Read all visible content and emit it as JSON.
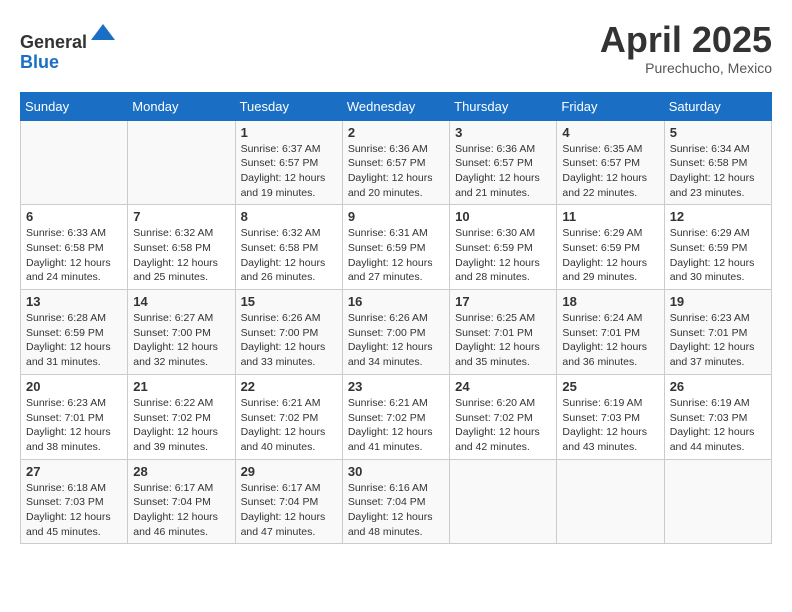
{
  "header": {
    "logo_line1": "General",
    "logo_line2": "Blue",
    "month": "April 2025",
    "location": "Purechucho, Mexico"
  },
  "weekdays": [
    "Sunday",
    "Monday",
    "Tuesday",
    "Wednesday",
    "Thursday",
    "Friday",
    "Saturday"
  ],
  "weeks": [
    [
      {
        "day": "",
        "sunrise": "",
        "sunset": "",
        "daylight": ""
      },
      {
        "day": "",
        "sunrise": "",
        "sunset": "",
        "daylight": ""
      },
      {
        "day": "1",
        "sunrise": "Sunrise: 6:37 AM",
        "sunset": "Sunset: 6:57 PM",
        "daylight": "Daylight: 12 hours and 19 minutes."
      },
      {
        "day": "2",
        "sunrise": "Sunrise: 6:36 AM",
        "sunset": "Sunset: 6:57 PM",
        "daylight": "Daylight: 12 hours and 20 minutes."
      },
      {
        "day": "3",
        "sunrise": "Sunrise: 6:36 AM",
        "sunset": "Sunset: 6:57 PM",
        "daylight": "Daylight: 12 hours and 21 minutes."
      },
      {
        "day": "4",
        "sunrise": "Sunrise: 6:35 AM",
        "sunset": "Sunset: 6:57 PM",
        "daylight": "Daylight: 12 hours and 22 minutes."
      },
      {
        "day": "5",
        "sunrise": "Sunrise: 6:34 AM",
        "sunset": "Sunset: 6:58 PM",
        "daylight": "Daylight: 12 hours and 23 minutes."
      }
    ],
    [
      {
        "day": "6",
        "sunrise": "Sunrise: 6:33 AM",
        "sunset": "Sunset: 6:58 PM",
        "daylight": "Daylight: 12 hours and 24 minutes."
      },
      {
        "day": "7",
        "sunrise": "Sunrise: 6:32 AM",
        "sunset": "Sunset: 6:58 PM",
        "daylight": "Daylight: 12 hours and 25 minutes."
      },
      {
        "day": "8",
        "sunrise": "Sunrise: 6:32 AM",
        "sunset": "Sunset: 6:58 PM",
        "daylight": "Daylight: 12 hours and 26 minutes."
      },
      {
        "day": "9",
        "sunrise": "Sunrise: 6:31 AM",
        "sunset": "Sunset: 6:59 PM",
        "daylight": "Daylight: 12 hours and 27 minutes."
      },
      {
        "day": "10",
        "sunrise": "Sunrise: 6:30 AM",
        "sunset": "Sunset: 6:59 PM",
        "daylight": "Daylight: 12 hours and 28 minutes."
      },
      {
        "day": "11",
        "sunrise": "Sunrise: 6:29 AM",
        "sunset": "Sunset: 6:59 PM",
        "daylight": "Daylight: 12 hours and 29 minutes."
      },
      {
        "day": "12",
        "sunrise": "Sunrise: 6:29 AM",
        "sunset": "Sunset: 6:59 PM",
        "daylight": "Daylight: 12 hours and 30 minutes."
      }
    ],
    [
      {
        "day": "13",
        "sunrise": "Sunrise: 6:28 AM",
        "sunset": "Sunset: 6:59 PM",
        "daylight": "Daylight: 12 hours and 31 minutes."
      },
      {
        "day": "14",
        "sunrise": "Sunrise: 6:27 AM",
        "sunset": "Sunset: 7:00 PM",
        "daylight": "Daylight: 12 hours and 32 minutes."
      },
      {
        "day": "15",
        "sunrise": "Sunrise: 6:26 AM",
        "sunset": "Sunset: 7:00 PM",
        "daylight": "Daylight: 12 hours and 33 minutes."
      },
      {
        "day": "16",
        "sunrise": "Sunrise: 6:26 AM",
        "sunset": "Sunset: 7:00 PM",
        "daylight": "Daylight: 12 hours and 34 minutes."
      },
      {
        "day": "17",
        "sunrise": "Sunrise: 6:25 AM",
        "sunset": "Sunset: 7:01 PM",
        "daylight": "Daylight: 12 hours and 35 minutes."
      },
      {
        "day": "18",
        "sunrise": "Sunrise: 6:24 AM",
        "sunset": "Sunset: 7:01 PM",
        "daylight": "Daylight: 12 hours and 36 minutes."
      },
      {
        "day": "19",
        "sunrise": "Sunrise: 6:23 AM",
        "sunset": "Sunset: 7:01 PM",
        "daylight": "Daylight: 12 hours and 37 minutes."
      }
    ],
    [
      {
        "day": "20",
        "sunrise": "Sunrise: 6:23 AM",
        "sunset": "Sunset: 7:01 PM",
        "daylight": "Daylight: 12 hours and 38 minutes."
      },
      {
        "day": "21",
        "sunrise": "Sunrise: 6:22 AM",
        "sunset": "Sunset: 7:02 PM",
        "daylight": "Daylight: 12 hours and 39 minutes."
      },
      {
        "day": "22",
        "sunrise": "Sunrise: 6:21 AM",
        "sunset": "Sunset: 7:02 PM",
        "daylight": "Daylight: 12 hours and 40 minutes."
      },
      {
        "day": "23",
        "sunrise": "Sunrise: 6:21 AM",
        "sunset": "Sunset: 7:02 PM",
        "daylight": "Daylight: 12 hours and 41 minutes."
      },
      {
        "day": "24",
        "sunrise": "Sunrise: 6:20 AM",
        "sunset": "Sunset: 7:02 PM",
        "daylight": "Daylight: 12 hours and 42 minutes."
      },
      {
        "day": "25",
        "sunrise": "Sunrise: 6:19 AM",
        "sunset": "Sunset: 7:03 PM",
        "daylight": "Daylight: 12 hours and 43 minutes."
      },
      {
        "day": "26",
        "sunrise": "Sunrise: 6:19 AM",
        "sunset": "Sunset: 7:03 PM",
        "daylight": "Daylight: 12 hours and 44 minutes."
      }
    ],
    [
      {
        "day": "27",
        "sunrise": "Sunrise: 6:18 AM",
        "sunset": "Sunset: 7:03 PM",
        "daylight": "Daylight: 12 hours and 45 minutes."
      },
      {
        "day": "28",
        "sunrise": "Sunrise: 6:17 AM",
        "sunset": "Sunset: 7:04 PM",
        "daylight": "Daylight: 12 hours and 46 minutes."
      },
      {
        "day": "29",
        "sunrise": "Sunrise: 6:17 AM",
        "sunset": "Sunset: 7:04 PM",
        "daylight": "Daylight: 12 hours and 47 minutes."
      },
      {
        "day": "30",
        "sunrise": "Sunrise: 6:16 AM",
        "sunset": "Sunset: 7:04 PM",
        "daylight": "Daylight: 12 hours and 48 minutes."
      },
      {
        "day": "",
        "sunrise": "",
        "sunset": "",
        "daylight": ""
      },
      {
        "day": "",
        "sunrise": "",
        "sunset": "",
        "daylight": ""
      },
      {
        "day": "",
        "sunrise": "",
        "sunset": "",
        "daylight": ""
      }
    ]
  ]
}
